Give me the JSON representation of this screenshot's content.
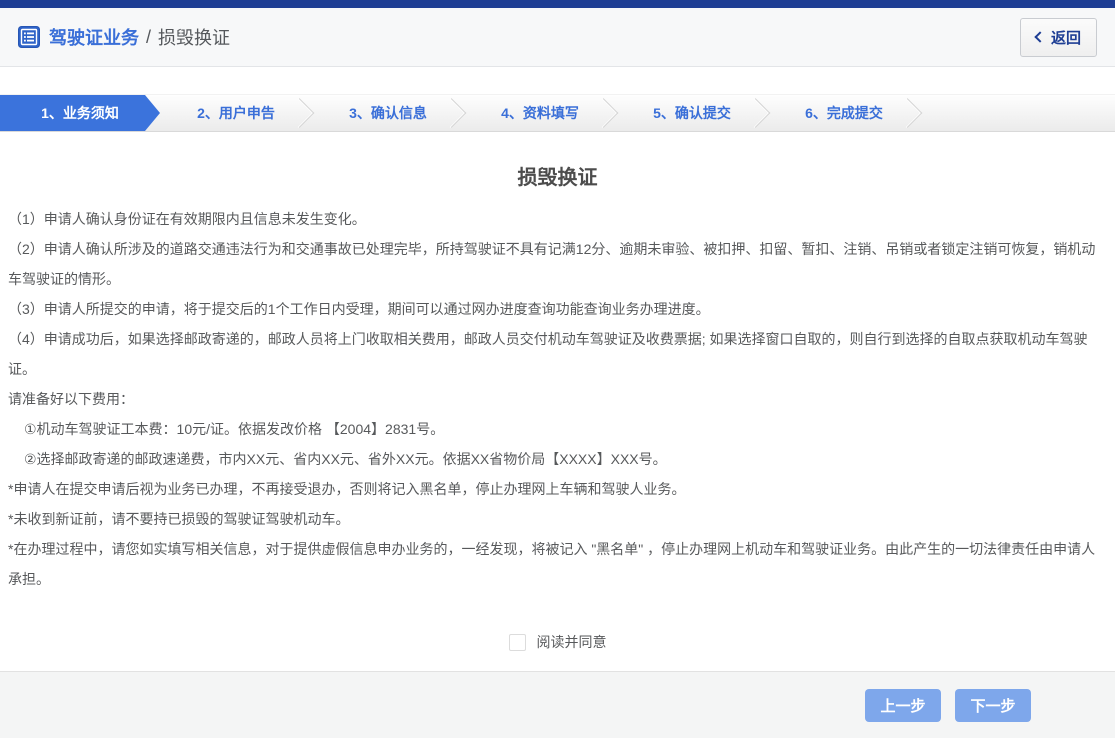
{
  "colors": {
    "top_bar": "#1e3e94",
    "accent_blue": "#3b73dc",
    "step_text_blue": "#3a6fd8",
    "button_blue": "#7ea7eb",
    "body_text": "#57595b"
  },
  "icons": {
    "breadcrumb": "menu-list-icon",
    "back": "chevron-left-icon"
  },
  "header": {
    "breadcrumb_primary": "驾驶证业务",
    "breadcrumb_separator": "/",
    "breadcrumb_secondary": "损毁换证",
    "back_label": "返回"
  },
  "steps": [
    {
      "label": "1、业务须知",
      "active": true
    },
    {
      "label": "2、用户申告",
      "active": false
    },
    {
      "label": "3、确认信息",
      "active": false
    },
    {
      "label": "4、资料填写",
      "active": false
    },
    {
      "label": "5、确认提交",
      "active": false
    },
    {
      "label": "6、完成提交",
      "active": false
    }
  ],
  "content": {
    "title": "损毁换证",
    "paragraphs": [
      "（1）申请人确认身份证在有效期限内且信息未发生变化。",
      "（2）申请人确认所涉及的道路交通违法行为和交通事故已处理完毕，所持驾驶证不具有记满12分、逾期未审验、被扣押、扣留、暂扣、注销、吊销或者锁定注销可恢复，销机动车驾驶证的情形。",
      "（3）申请人所提交的申请，将于提交后的1个工作日内受理，期间可以通过网办进度查询功能查询业务办理进度。",
      "（4）申请成功后，如果选择邮政寄递的，邮政人员将上门收取相关费用，邮政人员交付机动车驾驶证及收费票据; 如果选择窗口自取的，则自行到选择的自取点获取机动车驾驶证。",
      "请准备好以下费用：",
      "①机动车驾驶证工本费：10元/证。依据发改价格 【2004】2831号。",
      "②选择邮政寄递的邮政速递费，市内XX元、省内XX元、省外XX元。依据XX省物价局【XXXX】XXX号。",
      "*申请人在提交申请后视为业务已办理，不再接受退办，否则将记入黑名单，停止办理网上车辆和驾驶人业务。",
      "*未收到新证前，请不要持已损毁的驾驶证驾驶机动车。",
      "*在办理过程中，请您如实填写相关信息，对于提供虚假信息申办业务的，一经发现，将被记入 \"黑名单\" ，停止办理网上机动车和驾驶证业务。由此产生的一切法律责任由申请人承担。"
    ],
    "agree_label": "阅读并同意",
    "agree_checked": false
  },
  "footer": {
    "prev_label": "上一步",
    "next_label": "下一步"
  }
}
